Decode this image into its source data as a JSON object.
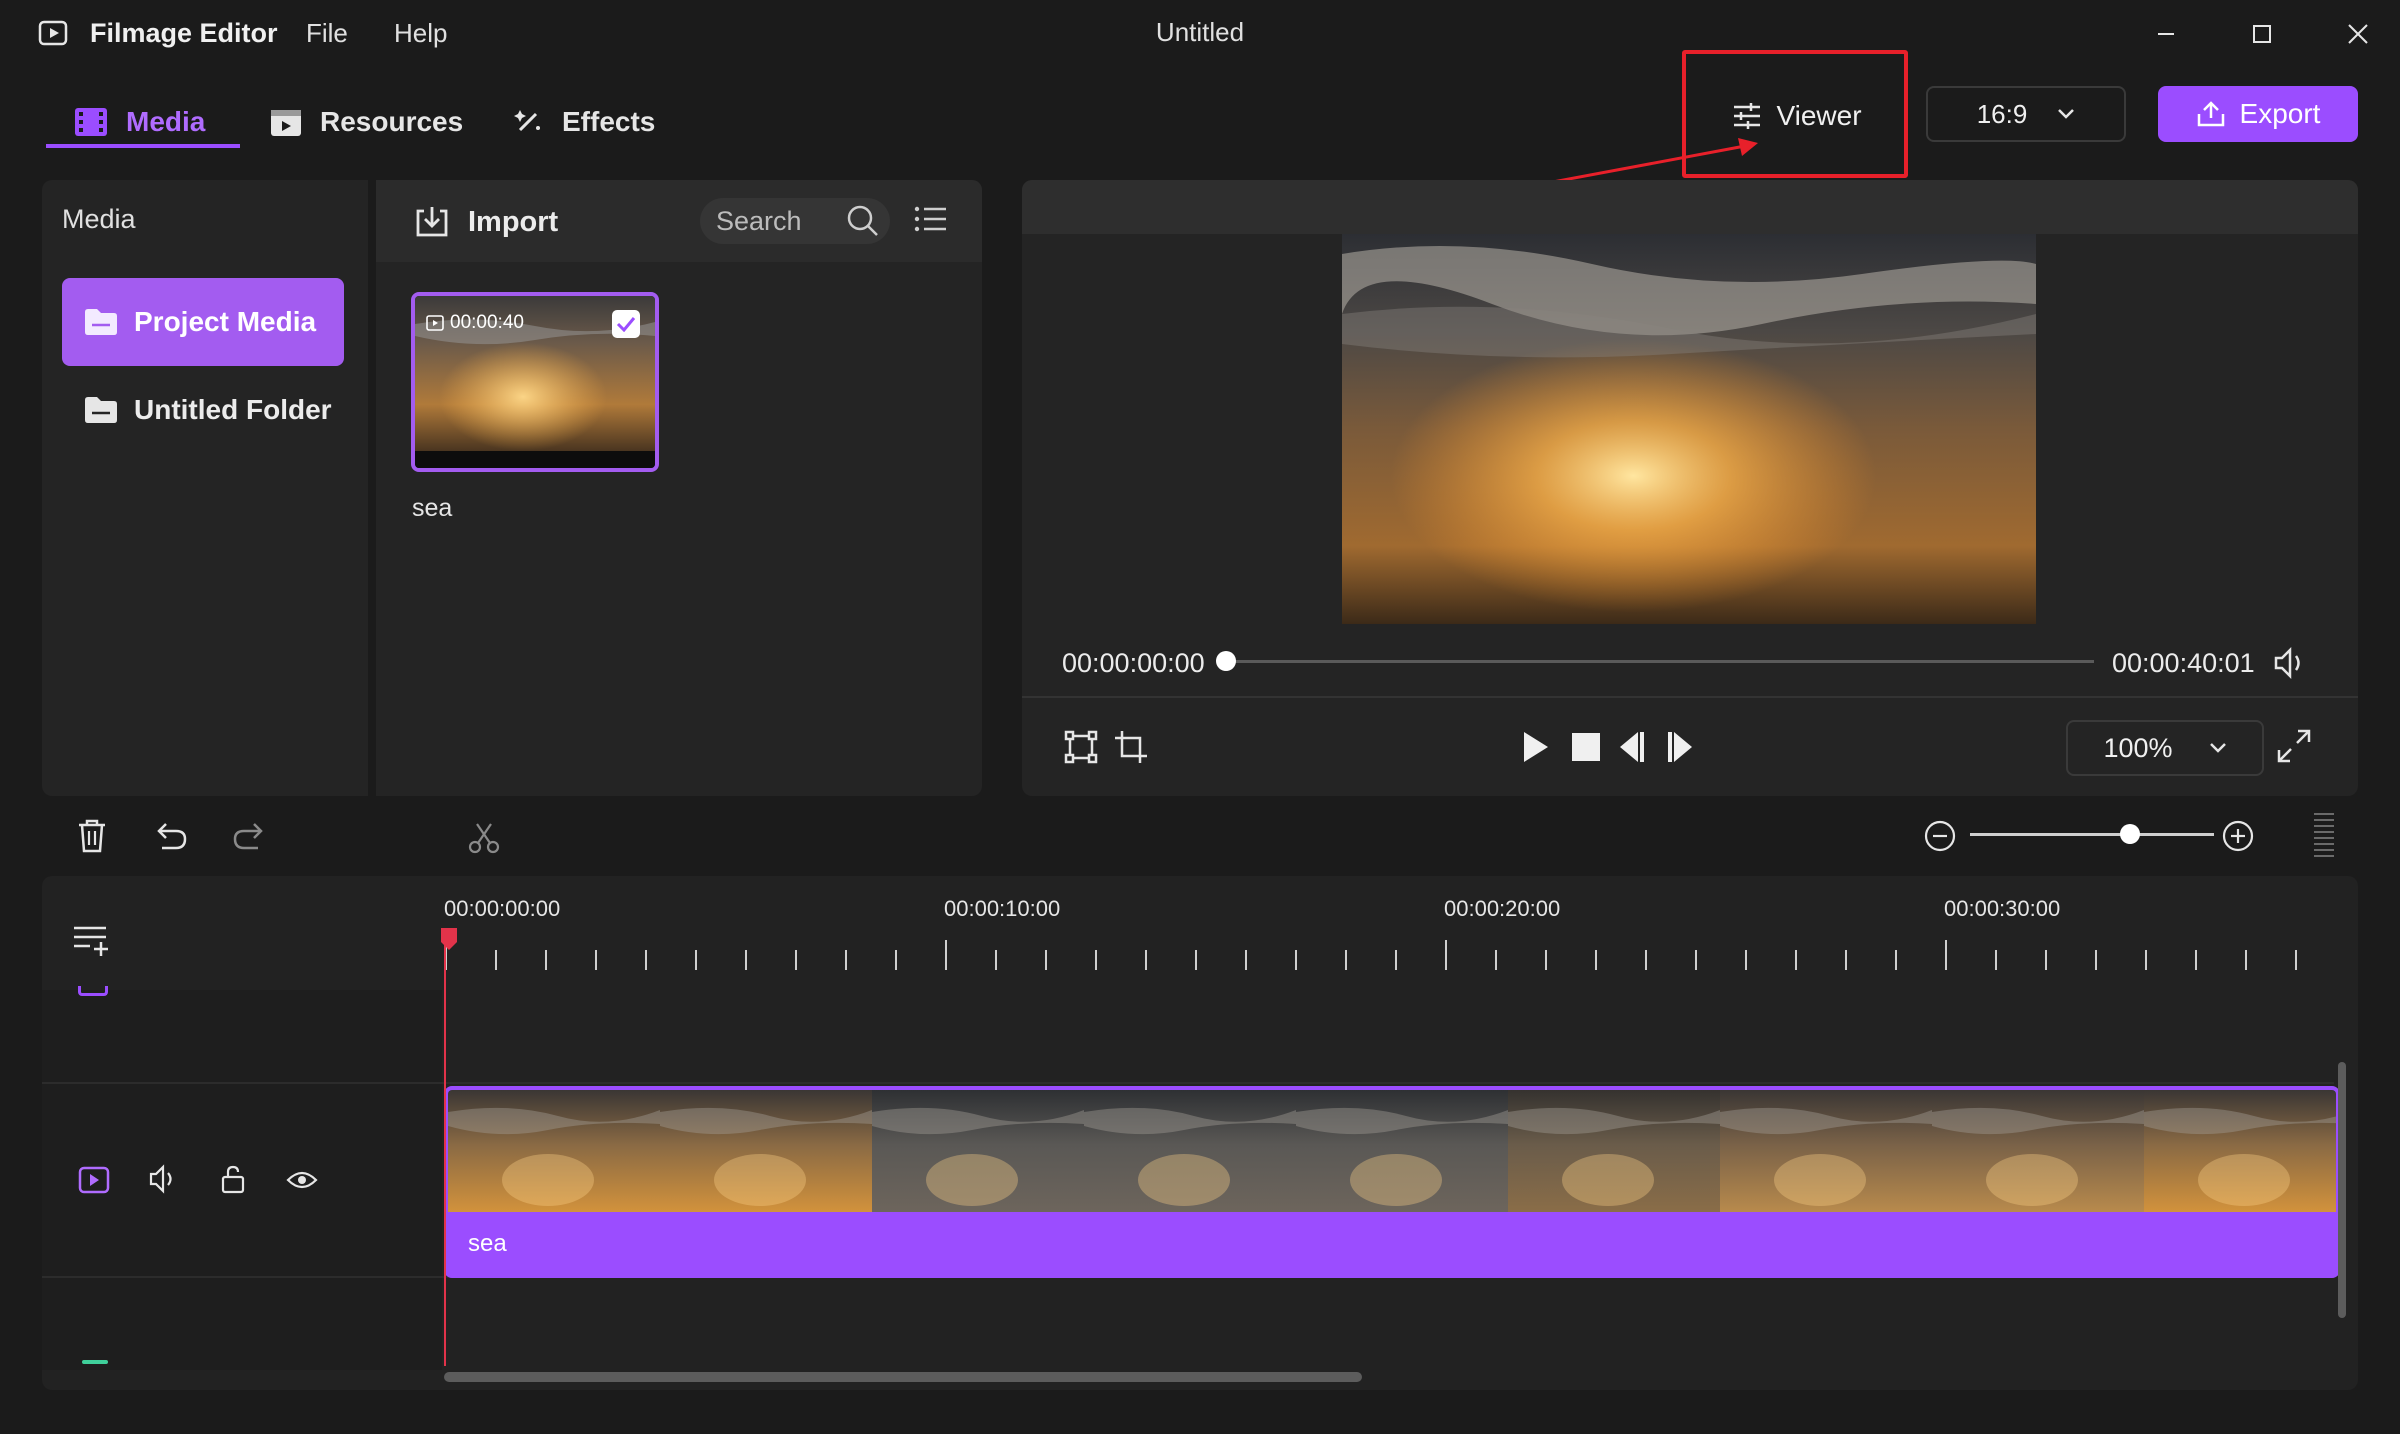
{
  "app": {
    "name": "Filmage Editor",
    "window_title": "Untitled"
  },
  "menu": {
    "file": "File",
    "help": "Help"
  },
  "tabs": [
    {
      "label": "Media",
      "active": true
    },
    {
      "label": "Resources",
      "active": false
    },
    {
      "label": "Effects",
      "active": false
    }
  ],
  "viewer": {
    "label": "Viewer"
  },
  "aspect_ratio": {
    "value": "16:9"
  },
  "export": {
    "label": "Export"
  },
  "sidebar": {
    "heading": "Media",
    "items": [
      {
        "label": "Project Media",
        "active": true
      },
      {
        "label": "Untitled Folder",
        "active": false
      }
    ]
  },
  "library": {
    "import_label": "Import",
    "search_placeholder": "Search",
    "items": [
      {
        "name": "sea",
        "duration": "00:00:40",
        "selected": true
      }
    ]
  },
  "player": {
    "current_time": "00:00:00:00",
    "total_time": "00:00:40:01",
    "progress": 0,
    "zoom": "100%"
  },
  "timeline": {
    "ruler_labels": [
      "00:00:00:00",
      "00:00:10:00",
      "00:00:20:00",
      "00:00:30:00"
    ],
    "clip": {
      "name": "sea"
    },
    "zoom_level": 0.62
  },
  "colors": {
    "accent": "#9b4dff",
    "playhead": "#e2334a",
    "highlight": "#e8202a"
  }
}
